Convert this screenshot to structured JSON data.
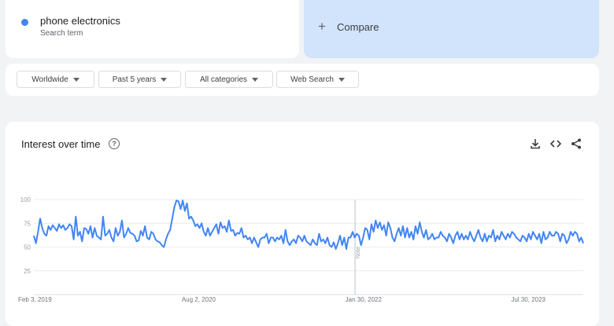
{
  "search_term": {
    "name": "phone electronics",
    "subtitle": "Search term",
    "color": "#4285f4"
  },
  "compare": {
    "label": "Compare"
  },
  "filters": [
    {
      "label": "Worldwide"
    },
    {
      "label": "Past 5 years"
    },
    {
      "label": "All categories"
    },
    {
      "label": "Web Search"
    }
  ],
  "chart": {
    "title": "Interest over time",
    "icons": [
      "help-icon",
      "download-icon",
      "embed-icon",
      "share-icon"
    ]
  },
  "chart_data": {
    "type": "line",
    "title": "Interest over time",
    "xlabel": "",
    "ylabel": "",
    "ylim": [
      0,
      100
    ],
    "yticks": [
      25,
      50,
      75,
      100
    ],
    "x_start": "2019-02-03",
    "x_end": "2024-01-28",
    "x_tick_labels": [
      {
        "date": "2019-02-03",
        "label": "Feb 3, 2019"
      },
      {
        "date": "2020-08-02",
        "label": "Aug 2, 2020"
      },
      {
        "date": "2022-01-30",
        "label": "Jan 30, 2022"
      },
      {
        "date": "2023-07-30",
        "label": "Jul 30, 2023"
      }
    ],
    "note": {
      "date": "2022-01-02",
      "label": "Note"
    },
    "series": [
      {
        "name": "phone electronics",
        "color": "#4285f4",
        "values": [
          62,
          54,
          66,
          80,
          70,
          64,
          62,
          72,
          68,
          73,
          70,
          67,
          74,
          70,
          73,
          68,
          70,
          74,
          72,
          58,
          82,
          62,
          66,
          56,
          70,
          69,
          64,
          72,
          60,
          70,
          62,
          60,
          58,
          82,
          62,
          64,
          68,
          60,
          56,
          70,
          62,
          66,
          78,
          60,
          64,
          70,
          65,
          64,
          62,
          56,
          57,
          67,
          62,
          72,
          60,
          58,
          66,
          64,
          58,
          56,
          55,
          52,
          50,
          58,
          64,
          68,
          80,
          92,
          99,
          98,
          90,
          99,
          88,
          96,
          80,
          82,
          78,
          72,
          74,
          70,
          75,
          66,
          62,
          70,
          62,
          66,
          70,
          74,
          64,
          76,
          70,
          72,
          66,
          78,
          67,
          68,
          62,
          65,
          64,
          70,
          60,
          62,
          58,
          60,
          54,
          60,
          55,
          50,
          58,
          60,
          60,
          64,
          54,
          60,
          60,
          56,
          60,
          58,
          62,
          54,
          68,
          56,
          52,
          56,
          58,
          54,
          62,
          60,
          56,
          62,
          56,
          54,
          52,
          58,
          54,
          52,
          64,
          56,
          58,
          54,
          60,
          52,
          50,
          55,
          48,
          54,
          62,
          52,
          60,
          48,
          60,
          60,
          66,
          60,
          64,
          62,
          52,
          60,
          70,
          68,
          58,
          74,
          66,
          78,
          70,
          76,
          68,
          73,
          62,
          76,
          70,
          60,
          56,
          64,
          70,
          62,
          72,
          60,
          70,
          60,
          66,
          58,
          72,
          64,
          76,
          66,
          60,
          68,
          58,
          60,
          64,
          58,
          60,
          60,
          66,
          62,
          60,
          56,
          64,
          60,
          54,
          62,
          66,
          58,
          64,
          58,
          62,
          58,
          66,
          60,
          56,
          62,
          68,
          60,
          56,
          64,
          56,
          62,
          60,
          68,
          56,
          62,
          58,
          66,
          62,
          58,
          64,
          60,
          66,
          64,
          60,
          58,
          56,
          62,
          60,
          56,
          64,
          58,
          66,
          62,
          58,
          64,
          54,
          66,
          58,
          60,
          66,
          62,
          62,
          66,
          64,
          56,
          64,
          62,
          54,
          58,
          66,
          62,
          66,
          64,
          56,
          60,
          54
        ]
      }
    ]
  }
}
